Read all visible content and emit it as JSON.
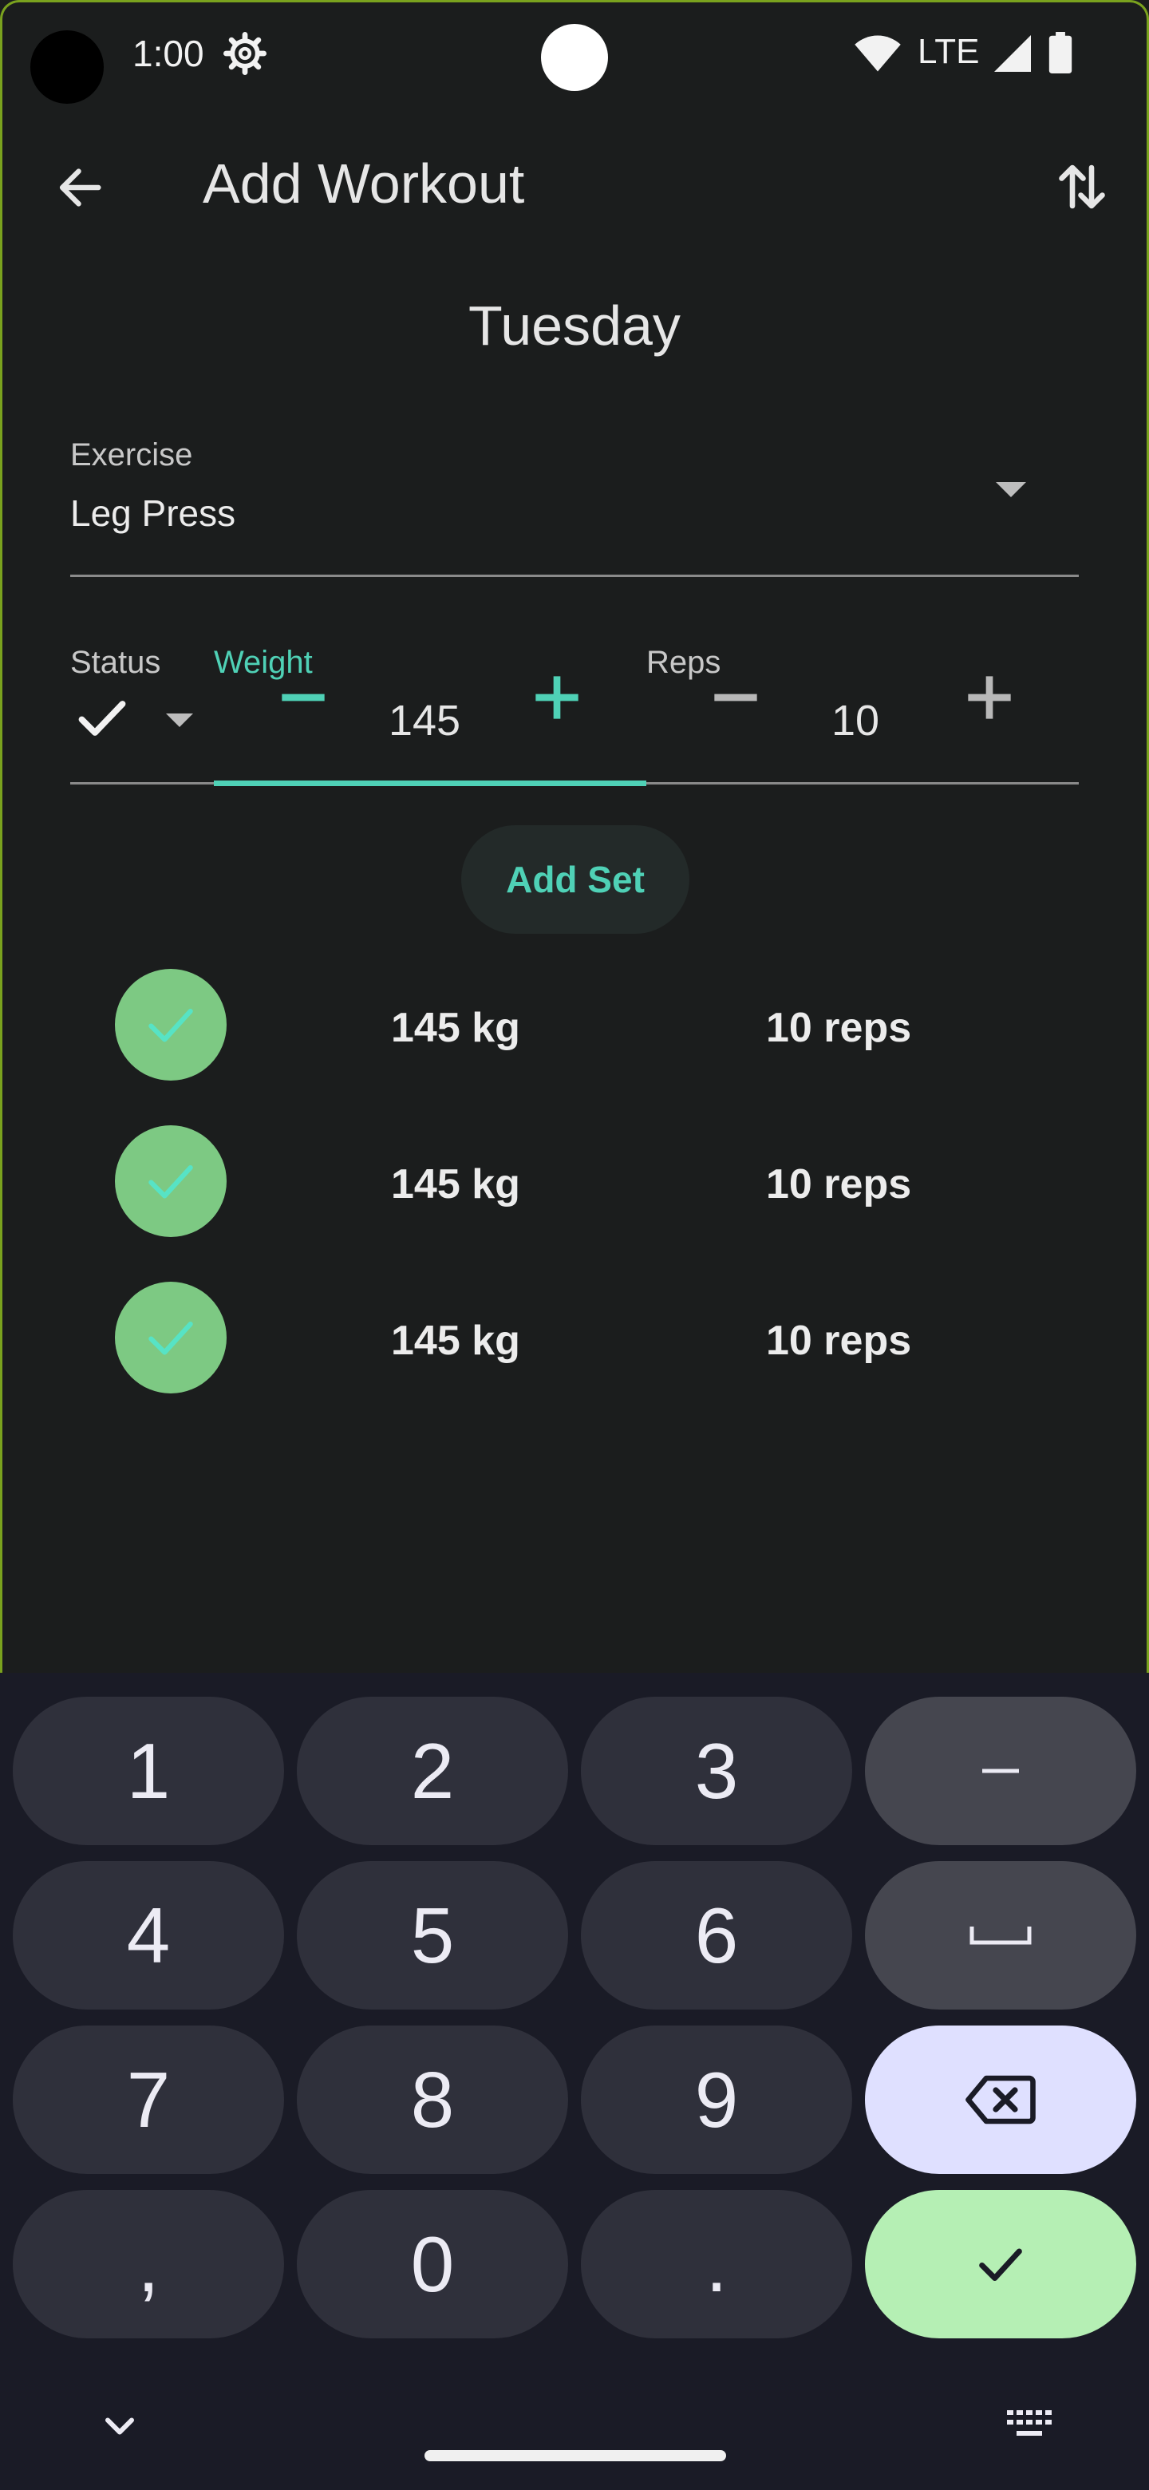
{
  "status_bar": {
    "time": "1:00",
    "network": "LTE"
  },
  "app_bar": {
    "title": "Add Workout"
  },
  "day": "Tuesday",
  "exercise": {
    "label": "Exercise",
    "value": "Leg Press"
  },
  "set_input": {
    "status_label": "Status",
    "weight_label": "Weight",
    "weight_value": "145",
    "reps_label": "Reps",
    "reps_value": "10"
  },
  "add_set_label": "Add Set",
  "sets": [
    {
      "weight": "145 kg",
      "reps": "10 reps",
      "status": "done"
    },
    {
      "weight": "145 kg",
      "reps": "10 reps",
      "status": "done"
    },
    {
      "weight": "145 kg",
      "reps": "10 reps",
      "status": "done"
    }
  ],
  "keyboard": {
    "keys": [
      [
        "1",
        "2",
        "3",
        "–"
      ],
      [
        "4",
        "5",
        "6",
        "␣"
      ],
      [
        "7",
        "8",
        "9",
        "backspace"
      ],
      [
        ",",
        "0",
        ".",
        "done"
      ]
    ]
  },
  "colors": {
    "accent": "#4fd1b6",
    "set_done": "#7dc983",
    "background": "#1b1d1d"
  }
}
